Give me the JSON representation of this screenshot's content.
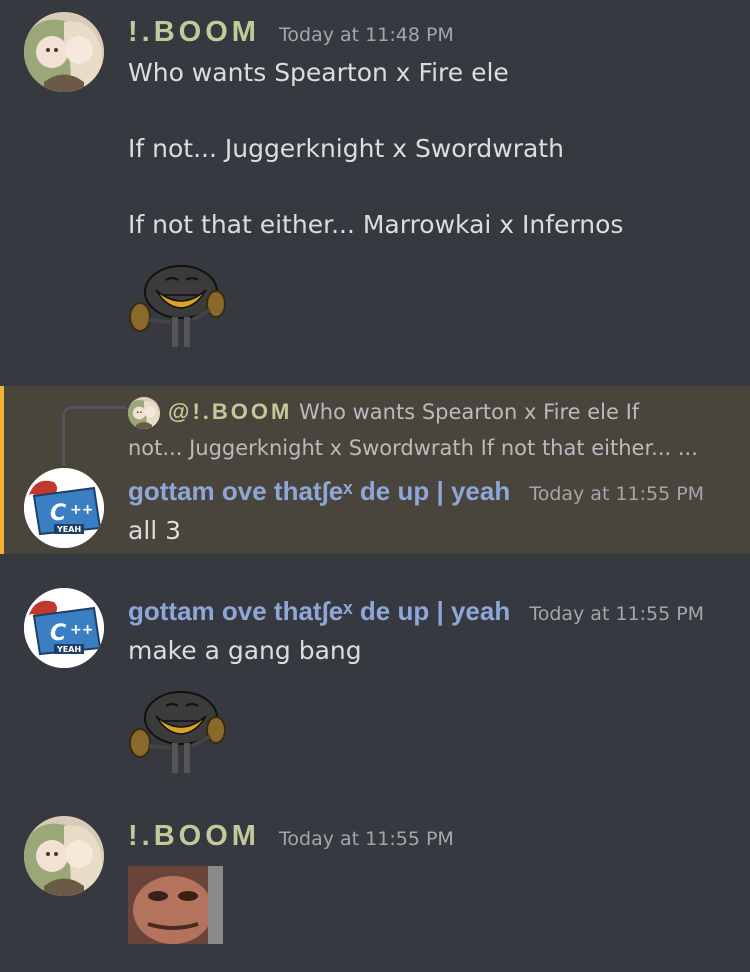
{
  "messages": {
    "m1": {
      "author": "!.BOOM",
      "timestamp": "Today at 11:48 PM",
      "lines": [
        "Who wants Spearton x Fire ele",
        "If not... Juggerknight x Swordwrath",
        "If not that either... Marrowkai x Infernos"
      ],
      "emoji": "trollface-emoji"
    },
    "m2": {
      "reply_to_author": "@!.BOOM",
      "reply_preview_line1": "Who wants Spearton x Fire ele  If",
      "reply_preview_line2": "not... Juggerknight x Swordwrath  If not that either... ...",
      "author": "gottam ove that∫eˣ de up | yeah",
      "timestamp": "Today at 11:55 PM",
      "text": "all 3",
      "avatar_text": "C++",
      "avatar_subtext": "YEAH"
    },
    "m3": {
      "author": "gottam ove that∫eˣ de up | yeah",
      "timestamp": "Today at 11:55 PM",
      "text": "make a gang bang",
      "avatar_text": "C++",
      "avatar_subtext": "YEAH",
      "emoji": "trollface-emoji"
    },
    "m4": {
      "author": "!.BOOM",
      "timestamp": "Today at 11:55 PM",
      "image": "face-meme-image"
    }
  },
  "colors": {
    "background": "#36393f",
    "boom_name": "#c3ca9a",
    "gottam_name": "#8ea7d8",
    "reply_highlight": "#49443c",
    "reply_accent": "#f0b232"
  }
}
